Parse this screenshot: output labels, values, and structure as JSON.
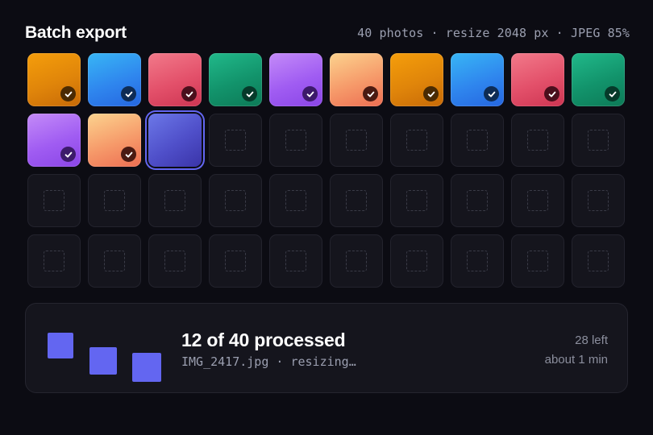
{
  "header": {
    "title": "Batch export",
    "meta": "40 photos · resize 2048 px · JPEG 85%"
  },
  "batch": {
    "total": 40,
    "processed": 12,
    "processed_tiles": [
      {
        "color": "orange",
        "check_bg": "#4a2a03"
      },
      {
        "color": "blue",
        "check_bg": "#0e2c55"
      },
      {
        "color": "red",
        "check_bg": "#4a0f1c"
      },
      {
        "color": "green",
        "check_bg": "#063a2a"
      },
      {
        "color": "purple",
        "check_bg": "#3c1a6a"
      },
      {
        "color": "peach",
        "check_bg": "#4a1a12"
      },
      {
        "color": "orange",
        "check_bg": "#4a2a03"
      },
      {
        "color": "blue",
        "check_bg": "#0e2c55"
      },
      {
        "color": "red",
        "check_bg": "#4a0f1c"
      },
      {
        "color": "green",
        "check_bg": "#063a2a"
      },
      {
        "color": "purple",
        "check_bg": "#3c1a6a"
      },
      {
        "color": "peach",
        "check_bg": "#4a1a12"
      }
    ],
    "active_index": 12
  },
  "colors": {
    "accent": "#6366f1",
    "background": "#0c0c13",
    "panel": "#15151d"
  },
  "progress": {
    "summary": "12 of 40 processed",
    "file_status": "IMG_2417.jpg · resizing…",
    "left": "28 left",
    "eta": "about 1 min"
  }
}
